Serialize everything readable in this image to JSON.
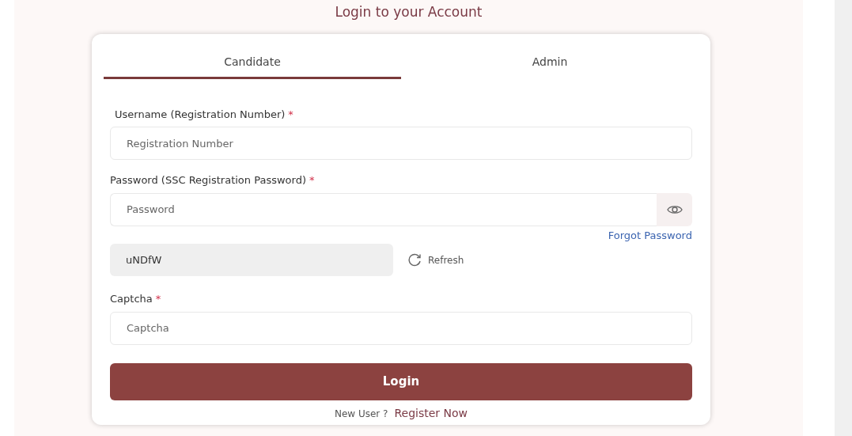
{
  "title": "Login to your Account",
  "tabs": [
    {
      "label": "Candidate",
      "selected": true
    },
    {
      "label": "Admin",
      "selected": false
    }
  ],
  "fields": [
    {
      "kind": "text",
      "label": "Username (Registration Number)",
      "required_mark": "*",
      "placeholder": "Registration Number"
    },
    {
      "kind": "password",
      "label": "Password (SSC Registration Password)",
      "required_mark": "*",
      "placeholder": "Password"
    }
  ],
  "forgot_link": "Forgot Password",
  "captcha": {
    "code": "uNDfW",
    "refresh": "Refresh",
    "label": "Captcha",
    "required_mark": "*",
    "placeholder": "Captcha"
  },
  "login_button": "Login",
  "footer": {
    "text": "New User ?",
    "link": "Register Now"
  }
}
